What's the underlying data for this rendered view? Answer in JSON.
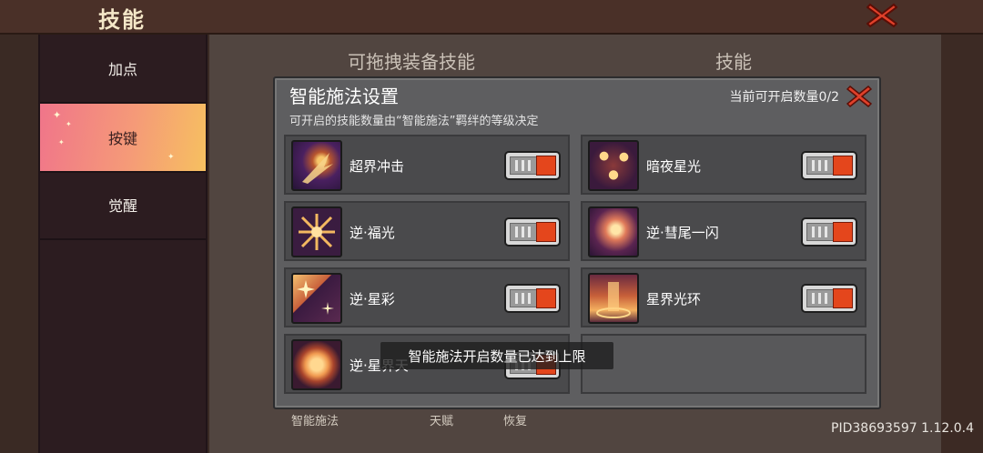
{
  "header": {
    "title": "技能"
  },
  "sidebar": {
    "items": [
      {
        "label": "加点",
        "active": false
      },
      {
        "label": "按键",
        "active": true
      },
      {
        "label": "觉醒",
        "active": false
      }
    ]
  },
  "main": {
    "left_heading": "可拖拽装备技能",
    "right_heading": "技能",
    "bottom_labels": [
      "智能施法",
      "天赋",
      "恢复"
    ]
  },
  "dialog": {
    "title": "智能施法设置",
    "subtitle": "可开启的技能数量由“智能施法”羁绊的等级决定",
    "count_text": "当前可开启数量0/2",
    "skills": [
      {
        "name": "超界冲击",
        "icon": "comet-strike-icon",
        "enabled": false
      },
      {
        "name": "暗夜星光",
        "icon": "night-stars-icon",
        "enabled": false
      },
      {
        "name": "逆·福光",
        "icon": "cross-light-icon",
        "enabled": false
      },
      {
        "name": "逆·彗尾一闪",
        "icon": "comet-tail-icon",
        "enabled": false
      },
      {
        "name": "逆·星彩",
        "icon": "star-slash-icon",
        "enabled": false
      },
      {
        "name": "星界光环",
        "icon": "star-halo-icon",
        "enabled": false
      },
      {
        "name": "逆·星界天",
        "icon": "star-sphere-icon",
        "enabled": false
      }
    ]
  },
  "toast": {
    "text": "智能施法开启数量已达到上限"
  },
  "footer": {
    "build": "PID38693597 1.12.0.4"
  },
  "colors": {
    "accent_red": "#e4461c",
    "active_tab_gradient": [
      "#f0758a",
      "#f6c060"
    ]
  }
}
